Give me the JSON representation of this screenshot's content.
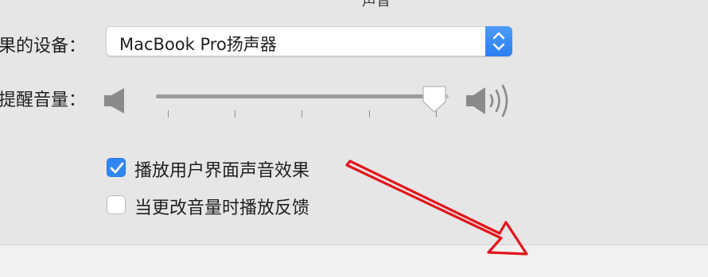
{
  "window": {
    "title_fragment": "声音"
  },
  "output": {
    "device_label": "果的设备：",
    "device_value": "MacBook Pro扬声器"
  },
  "alert_volume": {
    "label": "提醒音量：",
    "level": 0.95
  },
  "checkboxes": [
    {
      "label": "播放用户界面声音效果",
      "checked": true
    },
    {
      "label": "当更改音量时播放反馈",
      "checked": false
    }
  ],
  "colors": {
    "accent": "#2f87f2",
    "annotation_arrow": "#e2141b"
  },
  "icons": {
    "select_arrows": "up-down-chevrons-icon",
    "volume_low": "speaker-mute-icon",
    "volume_high": "speaker-loud-icon",
    "checkmark": "checkmark-icon",
    "annotation": "red-arrow-annotation"
  }
}
